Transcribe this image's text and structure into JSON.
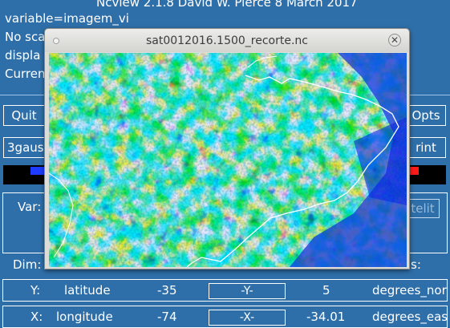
{
  "header": {
    "title": "Ncview 2.1.8 David W. Pierce  8 March 2017",
    "variable_line": "variable=imagem_vi",
    "scan_line": "No sca",
    "display_line": "displa",
    "current_line": "Curren"
  },
  "buttons": {
    "quit": "Quit",
    "opts": "Opts",
    "colormap": "3gaus",
    "print": "rint",
    "var_extra": "telit"
  },
  "var_label": "Var:",
  "dim_label": "Dim:",
  "units_fragment": "s:",
  "dims": [
    {
      "dim": "Y:",
      "name": "latitude",
      "min": "-35",
      "button": "-Y-",
      "max": "5",
      "units": "degrees_nor"
    },
    {
      "dim": "X:",
      "name": "longitude",
      "min": "-74",
      "button": "-X-",
      "max": "-34.01",
      "units": "degrees_eas"
    }
  ],
  "colorbar": {
    "left_color": "#1e3cff",
    "right_color": "#ff1a1a"
  },
  "window": {
    "title": "sat0012016.1500_recorte.nc",
    "close_glyph": "✕"
  }
}
